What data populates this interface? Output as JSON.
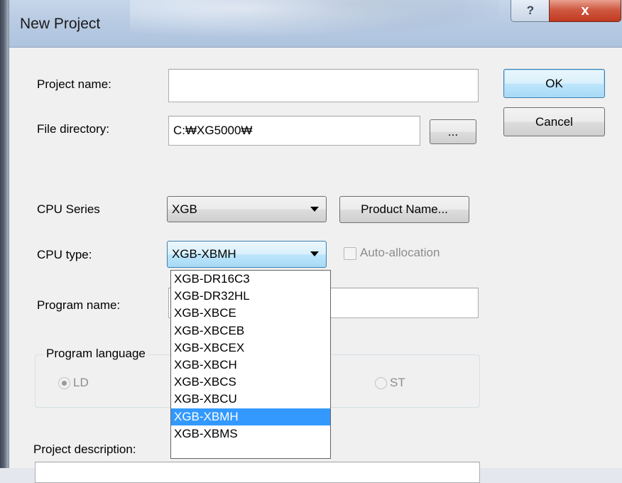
{
  "dialog": {
    "title": "New Project",
    "help_glyph": "?",
    "close_glyph": "x"
  },
  "fields": {
    "project_name_label": "Project name:",
    "project_name_value": "",
    "file_directory_label": "File directory:",
    "file_directory_value": "C:₩XG5000₩",
    "browse_label": "...",
    "cpu_series_label": "CPU Series",
    "cpu_series_value": "XGB",
    "product_name_label": "Product Name...",
    "cpu_type_label": "CPU type:",
    "cpu_type_value": "XGB-XBMH",
    "auto_allocation_label": "Auto-allocation",
    "program_name_label": "Program name:",
    "program_name_value": "",
    "program_language_label": "Program language",
    "radio_ld_label": "LD",
    "radio_st_label": "ST",
    "project_description_label": "Project description:"
  },
  "buttons": {
    "ok": "OK",
    "cancel": "Cancel"
  },
  "cpu_type_options": [
    "XGB-DR16C3",
    "XGB-DR32HL",
    "XGB-XBCE",
    "XGB-XBCEB",
    "XGB-XBCEX",
    "XGB-XBCH",
    "XGB-XBCS",
    "XGB-XBCU",
    "XGB-XBMH",
    "XGB-XBMS"
  ],
  "cpu_type_selected_index": 8,
  "colors": {
    "selection_highlight": "#3399ff",
    "close_button": "#c0391f",
    "default_button_border": "#3c7fb1"
  }
}
